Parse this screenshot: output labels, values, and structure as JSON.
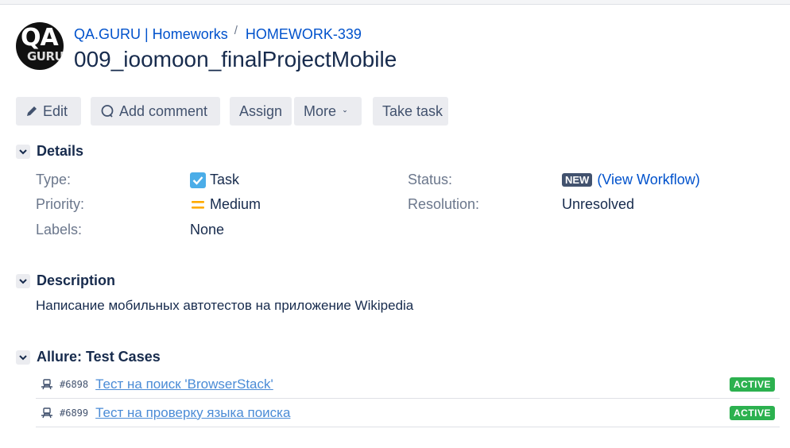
{
  "breadcrumb": {
    "project": "QA.GURU | Homeworks",
    "separator": "/",
    "issue_key": "HOMEWORK-339"
  },
  "logo": {
    "top": "QA",
    "bottom": "GURU"
  },
  "issue": {
    "title": "009_ioomoon_finalProjectMobile"
  },
  "toolbar": {
    "edit": "Edit",
    "add_comment": "Add comment",
    "assign": "Assign",
    "more": "More",
    "take_task": "Take task"
  },
  "details": {
    "heading": "Details",
    "type_label": "Type:",
    "type_value": "Task",
    "priority_label": "Priority:",
    "priority_value": "Medium",
    "labels_label": "Labels:",
    "labels_value": "None",
    "status_label": "Status:",
    "status_value": "NEW",
    "status_link_open": "(",
    "status_link": "View Workflow",
    "status_link_close": ")",
    "resolution_label": "Resolution:",
    "resolution_value": "Unresolved"
  },
  "description": {
    "heading": "Description",
    "text": "Написание мобильных автотестов на приложение Wikipedia"
  },
  "allure": {
    "heading": "Allure: Test Cases",
    "cases": [
      {
        "id": "#6898",
        "title": "Тест на поиск 'BrowserStack'",
        "status": "ACTIVE"
      },
      {
        "id": "#6899",
        "title": "Тест на проверку языка поиска",
        "status": "ACTIVE"
      }
    ]
  },
  "colors": {
    "link": "#0052cc",
    "active": "#2cb14f",
    "new_lozenge": "#42526e",
    "priority_medium": "#ffab00",
    "task_icon": "#4bade8"
  }
}
